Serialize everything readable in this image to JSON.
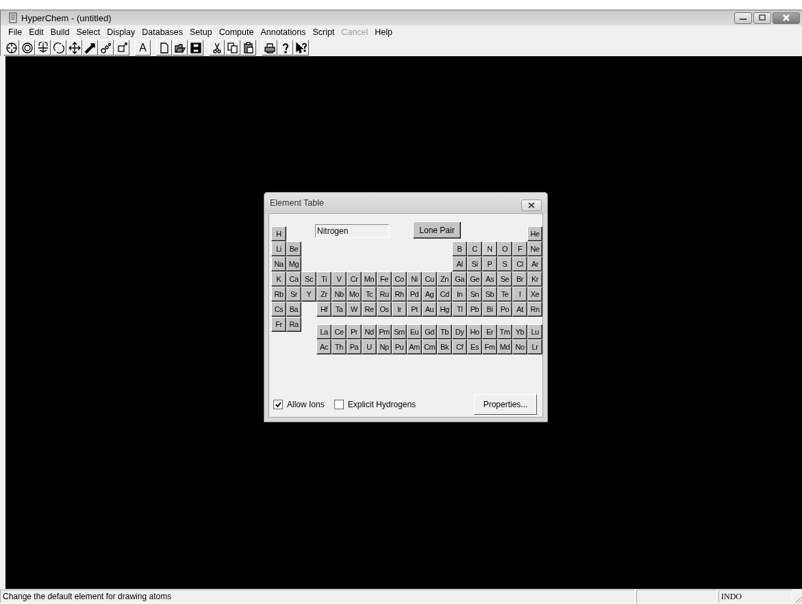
{
  "window": {
    "title": "HyperChem - (untitled)"
  },
  "menu": [
    {
      "label": "File",
      "disabled": false
    },
    {
      "label": "Edit",
      "disabled": false
    },
    {
      "label": "Build",
      "disabled": false
    },
    {
      "label": "Select",
      "disabled": false
    },
    {
      "label": "Display",
      "disabled": false
    },
    {
      "label": "Databases",
      "disabled": false
    },
    {
      "label": "Setup",
      "disabled": false
    },
    {
      "label": "Compute",
      "disabled": false
    },
    {
      "label": "Annotations",
      "disabled": false
    },
    {
      "label": "Script",
      "disabled": false
    },
    {
      "label": "Cancel",
      "disabled": true
    },
    {
      "label": "Help",
      "disabled": false
    }
  ],
  "toolbar": [
    [
      {
        "kind": "draw"
      },
      {
        "kind": "select"
      },
      {
        "kind": "rotate_xy"
      },
      {
        "kind": "rotate_z"
      },
      {
        "kind": "translate"
      },
      {
        "kind": "translate_z"
      },
      {
        "kind": "zoom"
      },
      {
        "kind": "clip"
      }
    ],
    [
      {
        "kind": "text",
        "label": "A"
      }
    ],
    [
      {
        "kind": "new"
      },
      {
        "kind": "open"
      },
      {
        "kind": "save"
      }
    ],
    [
      {
        "kind": "cut"
      },
      {
        "kind": "copy"
      },
      {
        "kind": "paste"
      }
    ],
    [
      {
        "kind": "print"
      },
      {
        "kind": "help"
      },
      {
        "kind": "context_help"
      }
    ]
  ],
  "element_table": {
    "title": "Element Table",
    "element_name": "Nitrogen",
    "lone_pair_button": "Lone Pair",
    "rows": [
      [
        {
          "symbol": "H",
          "selected": false
        },
        null,
        null,
        null,
        null,
        null,
        null,
        null,
        null,
        null,
        null,
        null,
        null,
        null,
        null,
        null,
        null,
        {
          "symbol": "He",
          "selected": false
        }
      ],
      [
        {
          "symbol": "Li",
          "selected": false
        },
        {
          "symbol": "Be",
          "selected": false
        },
        null,
        null,
        null,
        null,
        null,
        null,
        null,
        null,
        null,
        null,
        {
          "symbol": "B",
          "selected": false
        },
        {
          "symbol": "C",
          "selected": false
        },
        {
          "symbol": "N",
          "selected": true
        },
        {
          "symbol": "O",
          "selected": false
        },
        {
          "symbol": "F",
          "selected": false
        },
        {
          "symbol": "Ne",
          "selected": false
        }
      ],
      [
        {
          "symbol": "Na",
          "selected": false
        },
        {
          "symbol": "Mg",
          "selected": false
        },
        null,
        null,
        null,
        null,
        null,
        null,
        null,
        null,
        null,
        null,
        {
          "symbol": "Al",
          "selected": false
        },
        {
          "symbol": "Si",
          "selected": false
        },
        {
          "symbol": "P",
          "selected": false
        },
        {
          "symbol": "S",
          "selected": false
        },
        {
          "symbol": "Cl",
          "selected": false
        },
        {
          "symbol": "Ar",
          "selected": false
        }
      ],
      [
        {
          "symbol": "K",
          "selected": false
        },
        {
          "symbol": "Ca",
          "selected": false
        },
        {
          "symbol": "Sc",
          "selected": false
        },
        {
          "symbol": "Ti",
          "selected": false
        },
        {
          "symbol": "V",
          "selected": false
        },
        {
          "symbol": "Cr",
          "selected": false
        },
        {
          "symbol": "Mn",
          "selected": false
        },
        {
          "symbol": "Fe",
          "selected": false
        },
        {
          "symbol": "Co",
          "selected": false
        },
        {
          "symbol": "Ni",
          "selected": false
        },
        {
          "symbol": "Cu",
          "selected": false
        },
        {
          "symbol": "Zn",
          "selected": false
        },
        {
          "symbol": "Ga",
          "selected": false
        },
        {
          "symbol": "Ge",
          "selected": false
        },
        {
          "symbol": "As",
          "selected": false
        },
        {
          "symbol": "Se",
          "selected": false
        },
        {
          "symbol": "Br",
          "selected": false
        },
        {
          "symbol": "Kr",
          "selected": false
        }
      ],
      [
        {
          "symbol": "Rb",
          "selected": false
        },
        {
          "symbol": "Sr",
          "selected": false
        },
        {
          "symbol": "Y",
          "selected": false
        },
        {
          "symbol": "Zr",
          "selected": false
        },
        {
          "symbol": "Nb",
          "selected": false
        },
        {
          "symbol": "Mo",
          "selected": false
        },
        {
          "symbol": "Tc",
          "selected": false
        },
        {
          "symbol": "Ru",
          "selected": false
        },
        {
          "symbol": "Rh",
          "selected": false
        },
        {
          "symbol": "Pd",
          "selected": false
        },
        {
          "symbol": "Ag",
          "selected": false
        },
        {
          "symbol": "Cd",
          "selected": false
        },
        {
          "symbol": "In",
          "selected": false
        },
        {
          "symbol": "Sn",
          "selected": false
        },
        {
          "symbol": "Sb",
          "selected": false
        },
        {
          "symbol": "Te",
          "selected": false
        },
        {
          "symbol": "I",
          "selected": false
        },
        {
          "symbol": "Xe",
          "selected": false
        }
      ],
      [
        {
          "symbol": "Cs",
          "selected": false
        },
        {
          "symbol": "Ba",
          "selected": false
        },
        null,
        {
          "symbol": "Hf",
          "selected": false
        },
        {
          "symbol": "Ta",
          "selected": false
        },
        {
          "symbol": "W",
          "selected": false
        },
        {
          "symbol": "Re",
          "selected": false
        },
        {
          "symbol": "Os",
          "selected": false
        },
        {
          "symbol": "Ir",
          "selected": false
        },
        {
          "symbol": "Pt",
          "selected": false
        },
        {
          "symbol": "Au",
          "selected": false
        },
        {
          "symbol": "Hg",
          "selected": false
        },
        {
          "symbol": "Tl",
          "selected": false
        },
        {
          "symbol": "Pb",
          "selected": false
        },
        {
          "symbol": "Bi",
          "selected": false
        },
        {
          "symbol": "Po",
          "selected": false
        },
        {
          "symbol": "At",
          "selected": false
        },
        {
          "symbol": "Rn",
          "selected": false
        }
      ],
      [
        {
          "symbol": "Fr",
          "selected": false
        },
        {
          "symbol": "Ra",
          "selected": false
        }
      ]
    ],
    "f_rows": [
      [
        {
          "symbol": "La",
          "selected": false
        },
        {
          "symbol": "Ce",
          "selected": false
        },
        {
          "symbol": "Pr",
          "selected": false
        },
        {
          "symbol": "Nd",
          "selected": false
        },
        {
          "symbol": "Pm",
          "selected": false
        },
        {
          "symbol": "Sm",
          "selected": false
        },
        {
          "symbol": "Eu",
          "selected": false
        },
        {
          "symbol": "Gd",
          "selected": false
        },
        {
          "symbol": "Tb",
          "selected": false
        },
        {
          "symbol": "Dy",
          "selected": false
        },
        {
          "symbol": "Ho",
          "selected": false
        },
        {
          "symbol": "Er",
          "selected": false
        },
        {
          "symbol": "Tm",
          "selected": false
        },
        {
          "symbol": "Yb",
          "selected": false
        },
        {
          "symbol": "Lu",
          "selected": false
        }
      ],
      [
        {
          "symbol": "Ac",
          "selected": false
        },
        {
          "symbol": "Th",
          "selected": false
        },
        {
          "symbol": "Pa",
          "selected": false
        },
        {
          "symbol": "U",
          "selected": false
        },
        {
          "symbol": "Np",
          "selected": false
        },
        {
          "symbol": "Pu",
          "selected": false
        },
        {
          "symbol": "Am",
          "selected": false
        },
        {
          "symbol": "Cm",
          "selected": false
        },
        {
          "symbol": "Bk",
          "selected": false
        },
        {
          "symbol": "Cf",
          "selected": false
        },
        {
          "symbol": "Es",
          "selected": false
        },
        {
          "symbol": "Fm",
          "selected": false
        },
        {
          "symbol": "Md",
          "selected": false
        },
        {
          "symbol": "No",
          "selected": false
        },
        {
          "symbol": "Lr",
          "selected": false
        }
      ]
    ],
    "options": [
      {
        "label": "Allow Ions",
        "checked": true
      },
      {
        "label": "Explicit Hydrogens",
        "checked": false
      }
    ],
    "properties_button": "Properties..."
  },
  "status_bar": {
    "message": "Change the default element for drawing atoms",
    "method": "INDO"
  }
}
